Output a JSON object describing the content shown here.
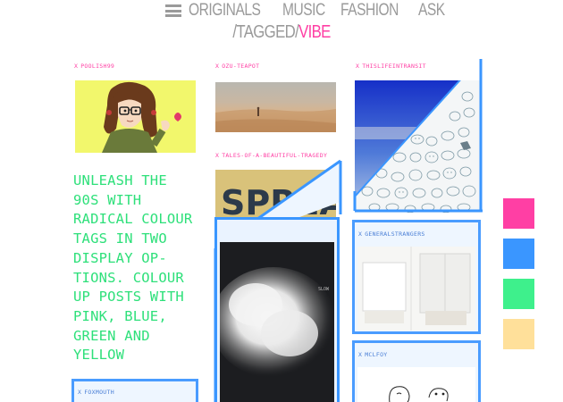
{
  "nav": {
    "items": [
      "ORIGINALS",
      "MUSIC",
      "FASHION",
      "ASK"
    ]
  },
  "tagline": {
    "prefix": "/TAGGED/",
    "tag": "VIBE"
  },
  "posts": [
    {
      "user": "POOLISH99"
    },
    {
      "user": "OZU-TEAPOT"
    },
    {
      "user": "THISLIFEINTRANSIT"
    },
    {
      "user": "TALES-OF-A-BEAUTIFUL-TRAGEDY"
    },
    {
      "user": "GENERALSTRANGERS"
    },
    {
      "user": "FOXMOUTH"
    },
    {
      "user": "MCLFOY"
    }
  ],
  "promo": {
    "text": "UNLEASH THE 90S WITH RADICAL COLOUR TAGS IN TWO DISPLAY OP- TIONS. COLOUR UP POSTS WITH PINK, BLUE, GREEN AND YELLOW"
  },
  "image_texts": {
    "spread": "SPREA",
    "slow": "SLOW"
  },
  "colors": {
    "pink": "#ff3fa4",
    "blue": "#3a96ff",
    "green": "#3ef08c",
    "yellow": "#ffe09a"
  },
  "swatches": [
    "pink",
    "blue",
    "green",
    "yellow"
  ]
}
